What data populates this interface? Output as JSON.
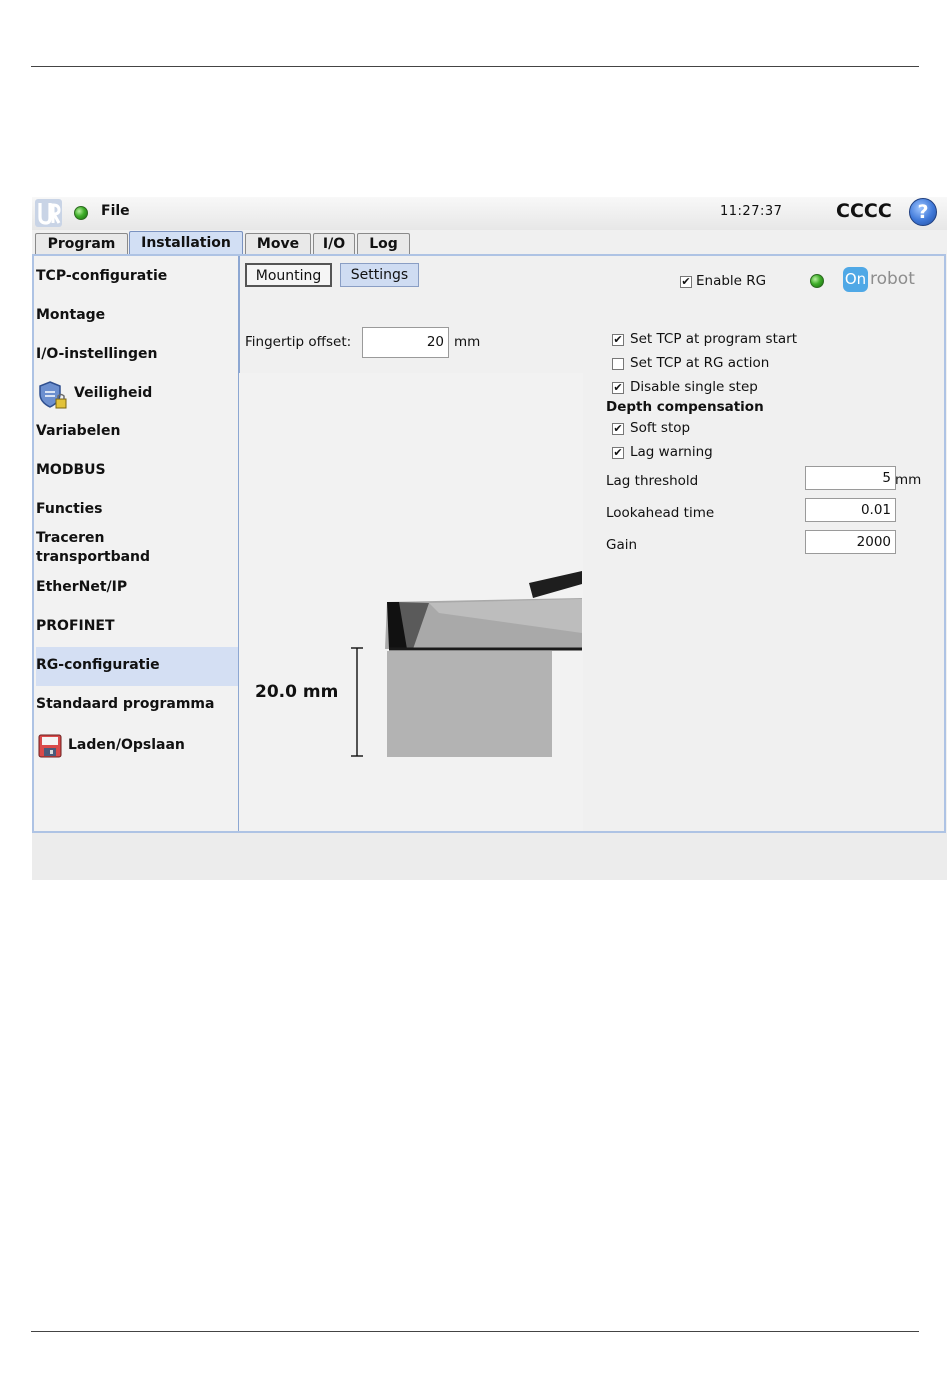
{
  "topbar": {
    "file_label": "File",
    "clock": "11:27:37",
    "robot_name": "CCCC",
    "help_symbol": "?"
  },
  "tabs": [
    {
      "label": "Program"
    },
    {
      "label": "Installation",
      "active": true
    },
    {
      "label": "Move"
    },
    {
      "label": "I/O"
    },
    {
      "label": "Log"
    }
  ],
  "sidebar": {
    "items": [
      {
        "label": "TCP-configuratie"
      },
      {
        "label": "Montage"
      },
      {
        "label": "I/O-instellingen"
      },
      {
        "label": "Veiligheid",
        "icon": "shield-lock-icon"
      },
      {
        "label": "Variabelen"
      },
      {
        "label": "MODBUS"
      },
      {
        "label": "Functies"
      },
      {
        "label_line1": "Traceren",
        "label_line2": "transportband"
      },
      {
        "label": "EtherNet/IP"
      },
      {
        "label": "PROFINET"
      },
      {
        "label": "RG-configuratie",
        "selected": true
      },
      {
        "label": "Standaard programma"
      },
      {
        "label": "Laden/Opslaan",
        "icon": "floppy-disk-icon"
      }
    ]
  },
  "content": {
    "subtabs": {
      "mounting": "Mounting",
      "settings": "Settings"
    },
    "enable_rg": {
      "label": "Enable RG",
      "checked": true
    },
    "logo": {
      "on": "On",
      "robot": "robot"
    },
    "fingertip": {
      "label": "Fingertip offset:",
      "value": "20",
      "unit": "mm"
    },
    "dimension_label": "20.0 mm",
    "options": {
      "set_tcp_start": {
        "label": "Set TCP at program start",
        "checked": true
      },
      "set_tcp_action": {
        "label": "Set TCP at RG action",
        "checked": false
      },
      "disable_single_step": {
        "label": "Disable single step",
        "checked": true
      }
    },
    "depth": {
      "heading": "Depth compensation",
      "soft_stop": {
        "label": "Soft stop",
        "checked": true
      },
      "lag_warning": {
        "label": "Lag warning",
        "checked": true
      }
    },
    "params": {
      "lag_threshold": {
        "label": "Lag threshold",
        "value": "5",
        "unit": "mm"
      },
      "lookahead": {
        "label": "Lookahead time",
        "value": "0.01"
      },
      "gain": {
        "label": "Gain",
        "value": "2000"
      }
    },
    "check_mark": "✔"
  },
  "colors": {
    "selected_bg": "#d4dff3",
    "panel_border": "#aec3e4",
    "status_led": "#3fae2a"
  }
}
